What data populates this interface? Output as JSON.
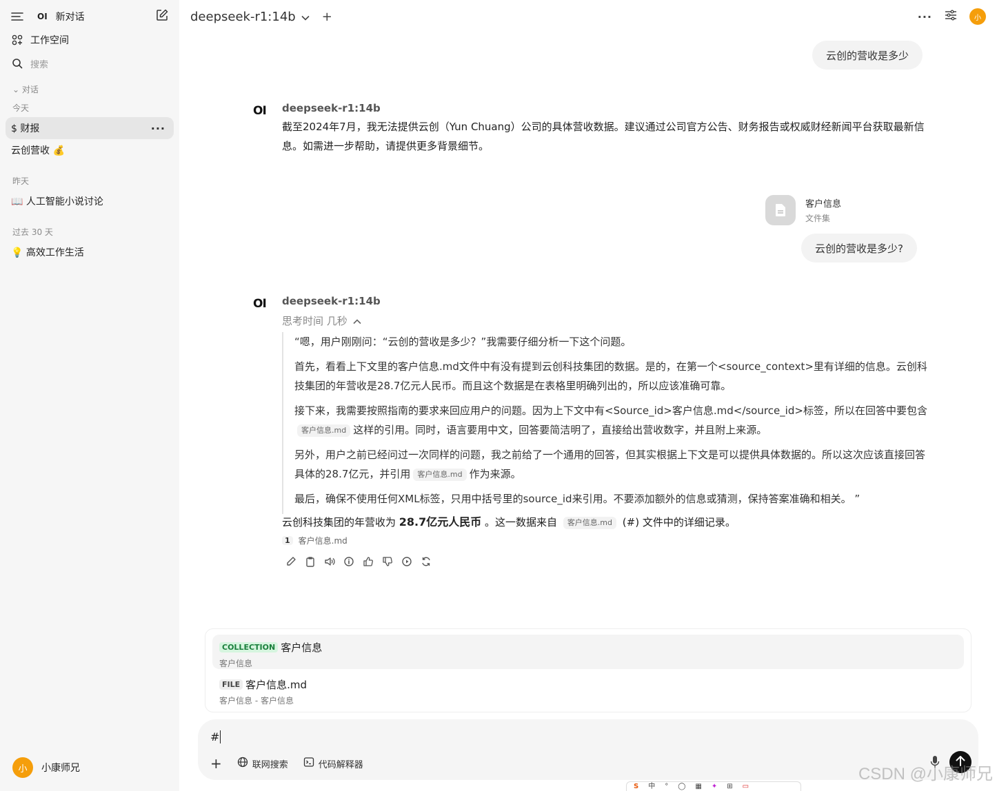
{
  "sidebar": {
    "new_chat": "新对话",
    "workspace": "工作空间",
    "search_placeholder": "搜索",
    "section_label": "对话",
    "groups": {
      "today": "今天",
      "yesterday": "昨天",
      "past30": "过去 30 天"
    },
    "chats_today": [
      {
        "label": "$ 财报",
        "active": true
      },
      {
        "label": "云创营收 💰",
        "active": false
      }
    ],
    "chats_yesterday": [
      {
        "label": "📖 人工智能小说讨论"
      }
    ],
    "chats_past30": [
      {
        "label": "💡 高效工作生活"
      }
    ],
    "user": {
      "avatar": "小",
      "name": "小康师兄"
    }
  },
  "topbar": {
    "model": "deepseek-r1:14b",
    "avatar": "小"
  },
  "chat": {
    "user_msg_1": "云创的营收是多少",
    "assistant_1": {
      "logo": "OI",
      "model": "deepseek-r1:14b",
      "text": "截至2024年7月，我无法提供云创（Yun Chuang）公司的具体营收数据。建议通过公司官方公告、财务报告或权威财经新闻平台获取最新信息。如需进一步帮助，请提供更多背景细节。"
    },
    "attachment": {
      "name": "客户信息",
      "type": "文件集"
    },
    "user_msg_2": "云创的营收是多少?",
    "assistant_2": {
      "logo": "OI",
      "model": "deepseek-r1:14b",
      "thinking_label": "思考时间 几秒",
      "thoughts": {
        "p1": "“嗯，用户刚刚问：“云创的营收是多少？”我需要仔细分析一下这个问题。",
        "p2": "首先，看看上下文里的客户信息.md文件中有没有提到云创科技集团的数据。是的，在第一个<source_context>里有详细的信息。云创科技集团的年营收是28.7亿元人民币。而且这个数据是在表格里明确列出的，所以应该准确可靠。",
        "p3a": "接下来，我需要按照指南的要求来回应用户的问题。因为上下文中有<Source_id>客户信息.md</source_id>标签，所以在回答中要包含",
        "p3cite": "客户信息.md",
        "p3b": "这样的引用。同时，语言要用中文，回答要简洁明了，直接给出营收数字，并且附上来源。",
        "p4a": "另外，用户之前已经问过一次同样的问题，我之前给了一个通用的回答，但其实根据上下文是可以提供具体数据的。所以这次应该直接回答具体的28.7亿元，并引用",
        "p4cite": "客户信息.md",
        "p4b": "作为来源。",
        "p5": "最后，确保不使用任何XML标签，只用中括号里的source_id来引用。不要添加额外的信息或猜测，保持答案准确和相关。 ”"
      },
      "answer_a": "云创科技集团的年营收为 ",
      "answer_bold": "28.7亿元人民币",
      "answer_b": " 。这一数据来自 ",
      "answer_cite": "客户信息.md",
      "answer_c": " (#) 文件中的详细记录。",
      "source_index": "1",
      "source_name": "客户信息.md"
    }
  },
  "popup": {
    "items": [
      {
        "tag": "COLLECTION",
        "title": "客户信息",
        "subtitle": "客户信息"
      },
      {
        "tag": "FILE",
        "title": "客户信息.md",
        "subtitle": "客户信息 - 客户信息"
      }
    ]
  },
  "composer": {
    "typed": "#",
    "web_search": "联网搜索",
    "code_interpreter": "代码解释器"
  },
  "watermark": "CSDN @小康师兄",
  "tray": [
    "中",
    "°",
    "◯",
    "▦",
    "✦",
    "⊞",
    "▭"
  ],
  "colors": {
    "accent_avatar": "#f59e0b",
    "collection_tag": "#d6f5df"
  }
}
